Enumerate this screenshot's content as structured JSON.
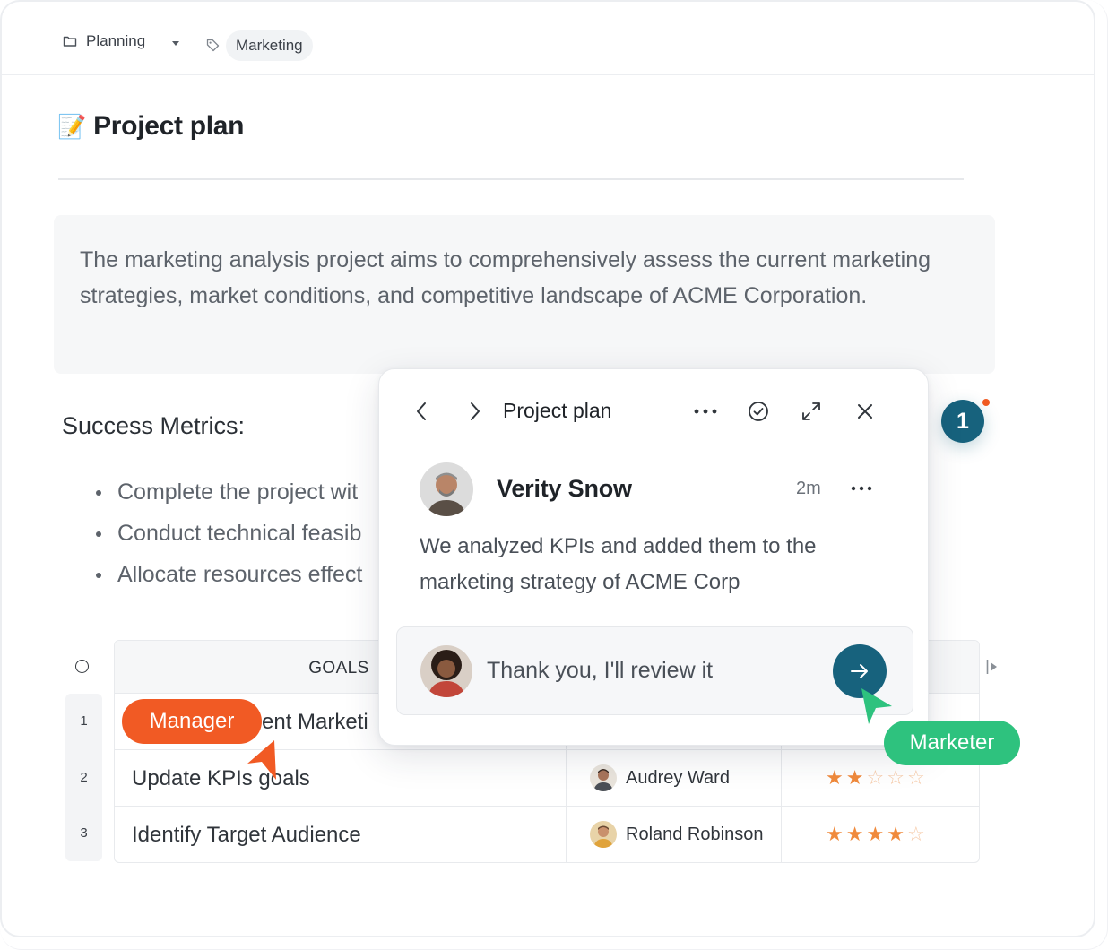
{
  "breadcrumb": {
    "folder_icon": "folder-icon",
    "folder_label": "Planning",
    "tag_icon": "tag-icon",
    "tag_label": "Marketing"
  },
  "document": {
    "title_emoji": "📝",
    "title": "Project plan",
    "description": "The marketing analysis project aims to comprehensively assess the current marketing strategies, market conditions, and competitive landscape of ACME Corporation.",
    "metrics_heading": "Success Metrics:",
    "metrics": [
      "Complete the project wit",
      "Conduct technical feasib",
      "Allocate resources effect"
    ]
  },
  "table": {
    "header_goals": "GOALS",
    "rows": [
      {
        "num": "1",
        "goal": "ent Marketi",
        "assignee": "",
        "rating": 0
      },
      {
        "num": "2",
        "goal": "Update KPIs goals",
        "assignee": "Audrey Ward",
        "rating": 2
      },
      {
        "num": "3",
        "goal": "Identify Target Audience",
        "assignee": "Roland Robinson",
        "rating": 4
      }
    ],
    "rating_max": 5
  },
  "comment_popup": {
    "title": "Project plan",
    "author": "Verity Snow",
    "time": "2m",
    "message": "We analyzed KPIs and added them to the marketing strategy of ACME Corp",
    "reply_text": "Thank you, I'll review it"
  },
  "notification_count": "1",
  "cursors": {
    "manager_label": "Manager",
    "manager_color": "#f15a24",
    "marketer_label": "Marketer",
    "marketer_color": "#2ec27e"
  },
  "colors": {
    "accent": "#17627d",
    "star": "#f08a3c"
  }
}
